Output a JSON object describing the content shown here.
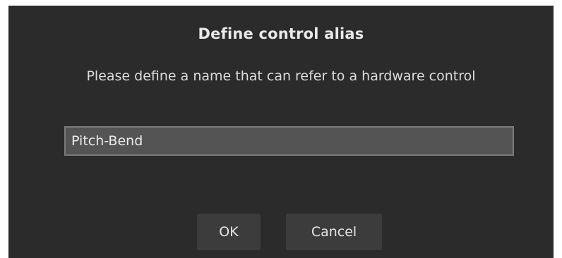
{
  "dialog": {
    "title": "Define control alias",
    "prompt": "Please define a name that can refer to a hardware control",
    "alias_input": {
      "value": "Pitch-Bend"
    },
    "buttons": {
      "ok_label": "OK",
      "cancel_label": "Cancel"
    }
  }
}
